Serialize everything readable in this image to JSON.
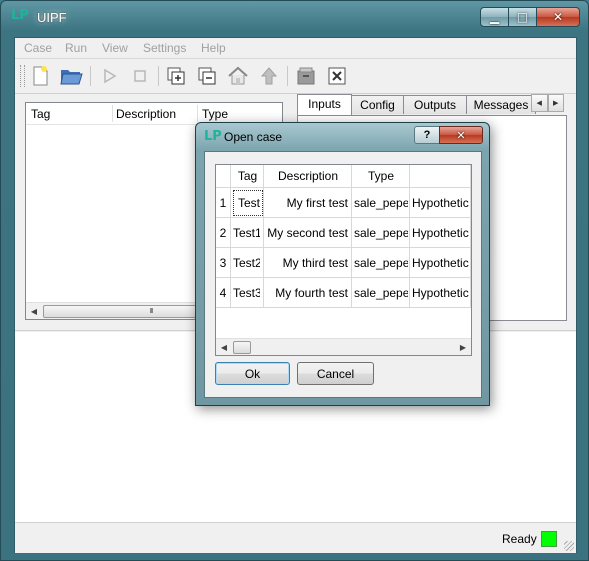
{
  "window": {
    "title": "UIPF",
    "controls": {
      "minimize": "▁",
      "maximize": "□",
      "close": "✕"
    }
  },
  "menu": [
    "Case",
    "Run",
    "View",
    "Settings",
    "Help"
  ],
  "toolbar": {
    "icons": [
      "new-case-icon",
      "open-case-icon",
      "run-icon",
      "stop-icon",
      "add-icon",
      "remove-icon",
      "home-icon",
      "up-icon",
      "archive-icon",
      "excel-icon"
    ]
  },
  "cases_list": {
    "columns": [
      "Tag",
      "Description",
      "Type"
    ]
  },
  "tabs": [
    "Inputs",
    "Config",
    "Outputs",
    "Messages"
  ],
  "active_tab": "Inputs",
  "status": {
    "text": "Ready",
    "indicator_color": "#00ff00"
  },
  "dialog": {
    "title": "Open case",
    "help_label": "?",
    "close_label": "✕",
    "columns": [
      "Tag",
      "Description",
      "Type",
      ""
    ],
    "rows": [
      {
        "num": "1",
        "tag": "Test",
        "description": "My first test",
        "type": "sale_pepe",
        "extra": "Hypothetic"
      },
      {
        "num": "2",
        "tag": "Test1",
        "description": "My second test",
        "type": "sale_pepe",
        "extra": "Hypothetic"
      },
      {
        "num": "3",
        "tag": "Test2",
        "description": "My third test",
        "type": "sale_pepe",
        "extra": "Hypothetic"
      },
      {
        "num": "4",
        "tag": "Test3",
        "description": "My fourth test",
        "type": "sale_pepe",
        "extra": "Hypothetic"
      }
    ],
    "ok_label": "Ok",
    "cancel_label": "Cancel"
  }
}
